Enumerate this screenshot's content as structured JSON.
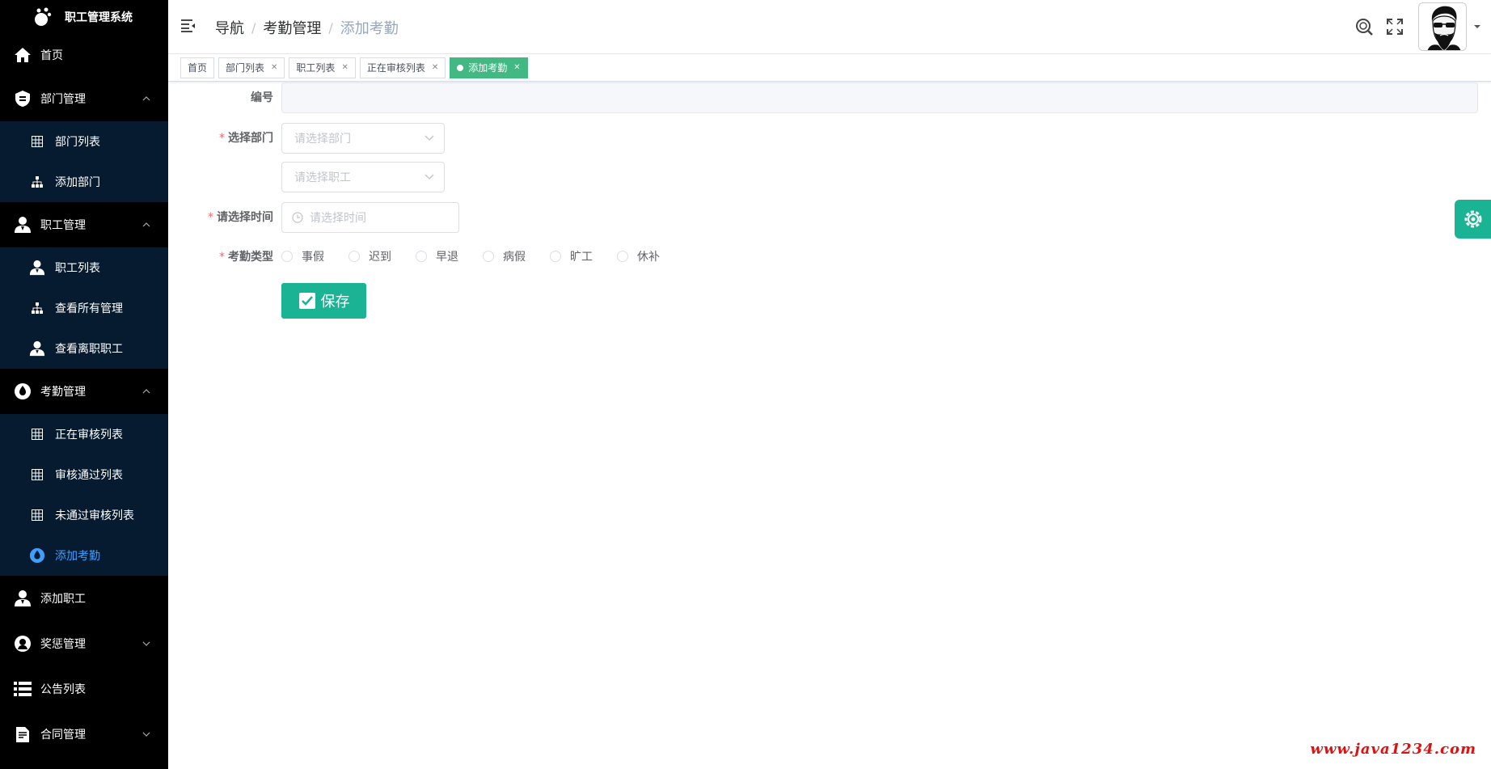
{
  "app": {
    "title": "职工管理系统"
  },
  "sidebar": {
    "items": [
      {
        "label": "首页",
        "icon": "home-icon"
      },
      {
        "label": "部门管理",
        "icon": "department-icon",
        "expanded": true,
        "children": [
          {
            "label": "部门列表",
            "icon": "table-icon"
          },
          {
            "label": "添加部门",
            "icon": "org-tree-icon"
          }
        ]
      },
      {
        "label": "职工管理",
        "icon": "user-icon",
        "expanded": true,
        "children": [
          {
            "label": "职工列表",
            "icon": "user-icon"
          },
          {
            "label": "查看所有管理",
            "icon": "org-tree-icon"
          },
          {
            "label": "查看离职职工",
            "icon": "user-icon"
          }
        ]
      },
      {
        "label": "考勤管理",
        "icon": "drop-icon",
        "expanded": true,
        "children": [
          {
            "label": "正在审核列表",
            "icon": "table-icon"
          },
          {
            "label": "审核通过列表",
            "icon": "table-icon"
          },
          {
            "label": "未通过审核列表",
            "icon": "table-icon"
          },
          {
            "label": "添加考勤",
            "icon": "drop-icon",
            "active": true
          }
        ]
      },
      {
        "label": "添加职工",
        "icon": "user-icon"
      },
      {
        "label": "奖惩管理",
        "icon": "award-icon",
        "expanded": false
      },
      {
        "label": "公告列表",
        "icon": "list-icon"
      },
      {
        "label": "合同管理",
        "icon": "contract-icon",
        "expanded": false
      }
    ]
  },
  "header": {
    "breadcrumb": [
      "导航",
      "考勤管理",
      "添加考勤"
    ]
  },
  "tags": [
    {
      "label": "首页",
      "closable": false
    },
    {
      "label": "部门列表",
      "closable": true
    },
    {
      "label": "职工列表",
      "closable": true
    },
    {
      "label": "正在审核列表",
      "closable": true
    },
    {
      "label": "添加考勤",
      "closable": true,
      "active": true
    }
  ],
  "form": {
    "id_label": "编号",
    "id_value": "",
    "dept_label": "选择部门",
    "dept_placeholder": "请选择部门",
    "employee_placeholder": "请选择职工",
    "time_label": "请选择时间",
    "time_placeholder": "请选择时间",
    "type_label": "考勤类型",
    "type_options": [
      "事假",
      "迟到",
      "早退",
      "病假",
      "旷工",
      "休补"
    ],
    "save_label": "保存"
  },
  "watermark": "www.java1234.com",
  "colors": {
    "sidebar_bg": "#000000",
    "submenu_bg": "#061b30",
    "active_tag": "#42b983",
    "primary_button": "#1ab394",
    "active_menu_text": "#409eff"
  }
}
